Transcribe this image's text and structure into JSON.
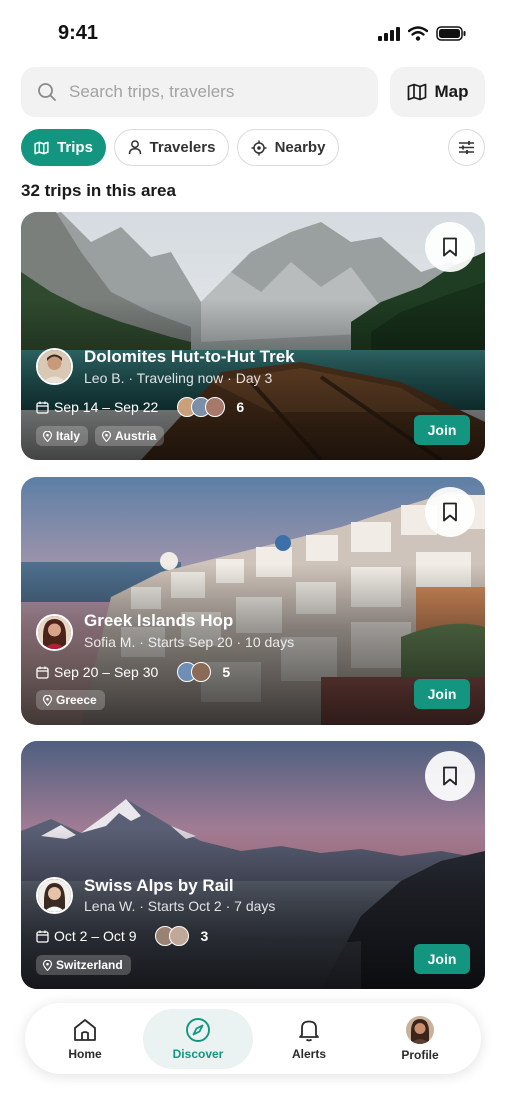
{
  "status_bar": {
    "time": "9:41"
  },
  "search": {
    "placeholder": "Search trips, travelers",
    "value": ""
  },
  "map_button": {
    "label": "Map"
  },
  "filters": [
    {
      "label": "Trips",
      "icon": "map-icon",
      "active": true
    },
    {
      "label": "Travelers",
      "icon": "person-icon",
      "active": false
    },
    {
      "label": "Nearby",
      "icon": "crosshair-icon",
      "active": false
    }
  ],
  "result_count": "32 trips in this area",
  "trips": [
    {
      "title": "Dolomites Hut-to-Hut Trek",
      "subtitle": "Leo B. · Traveling now · Day 3",
      "dates": "Sep 14 – Sep 22",
      "traveler_count": "6",
      "tags": [
        "Italy",
        "Austria"
      ],
      "join_label": "Join"
    },
    {
      "title": "Greek Islands Hop",
      "subtitle": "Sofia M. · Starts Sep 20 · 10 days",
      "dates": "Sep 20 – Sep 30",
      "traveler_count": "5",
      "tags": [
        "Greece"
      ],
      "join_label": "Join"
    },
    {
      "title": "Swiss Alps by Rail",
      "subtitle": "Lena W. · Starts Oct 2 · 7 days",
      "dates": "Oct 2 – Oct 9",
      "traveler_count": "3",
      "tags": [
        "Switzerland"
      ],
      "join_label": "Join"
    }
  ],
  "nav": [
    {
      "label": "Home",
      "icon": "home-icon",
      "active": false
    },
    {
      "label": "Discover",
      "icon": "compass-icon",
      "active": true
    },
    {
      "label": "Alerts",
      "icon": "bell-icon",
      "active": false
    },
    {
      "label": "Profile",
      "icon": "avatar",
      "active": false
    }
  ],
  "colors": {
    "accent": "#13957f",
    "surface": "#f2f2f2",
    "active_nav_bg": "#eaf3f1"
  }
}
